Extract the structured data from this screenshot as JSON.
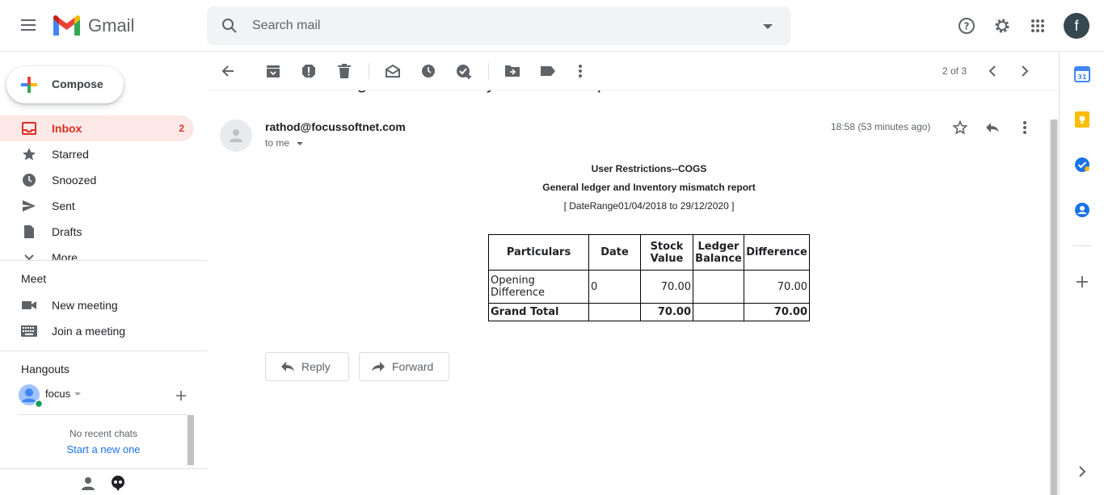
{
  "app": {
    "logo_text": "Gmail",
    "avatar_initial": "f"
  },
  "search": {
    "placeholder": "Search mail"
  },
  "compose": {
    "label": "Compose"
  },
  "sidebar": {
    "items": [
      {
        "label": "Inbox",
        "count": "2"
      },
      {
        "label": "Starred"
      },
      {
        "label": "Snoozed"
      },
      {
        "label": "Sent"
      },
      {
        "label": "Drafts"
      },
      {
        "label": "More"
      }
    ],
    "meet": {
      "title": "Meet",
      "new_meeting": "New meeting",
      "join_meeting": "Join a meeting"
    },
    "hangouts": {
      "title": "Hangouts",
      "user": "focus",
      "no_chats": "No recent chats",
      "start_link": "Start a new one"
    }
  },
  "toolbar": {
    "pager": "2 of 3"
  },
  "email": {
    "subject": "General ledger and Inventory mismatch report",
    "sender": "rathod@focussoftnet.com",
    "to": "to me",
    "time": "18:58 (53 minutes ago)",
    "report": {
      "title1": "User Restrictions--COGS",
      "title2": "General ledger and Inventory mismatch report",
      "range": "[ DateRange01/04/2018 to 29/12/2020 ]",
      "headers": [
        "Particulars",
        "Date",
        "Stock Value",
        "Ledger Balance",
        "Difference"
      ],
      "row": [
        "Opening Difference",
        "0",
        "70.00",
        "",
        "70.00"
      ],
      "total": [
        "Grand Total",
        "",
        "70.00",
        "",
        "70.00"
      ]
    },
    "reply_label": "Reply",
    "forward_label": "Forward"
  },
  "colors": {
    "accent_red": "#d93025",
    "inbox_bg": "#fce8e6",
    "link_blue": "#1a73e8"
  }
}
